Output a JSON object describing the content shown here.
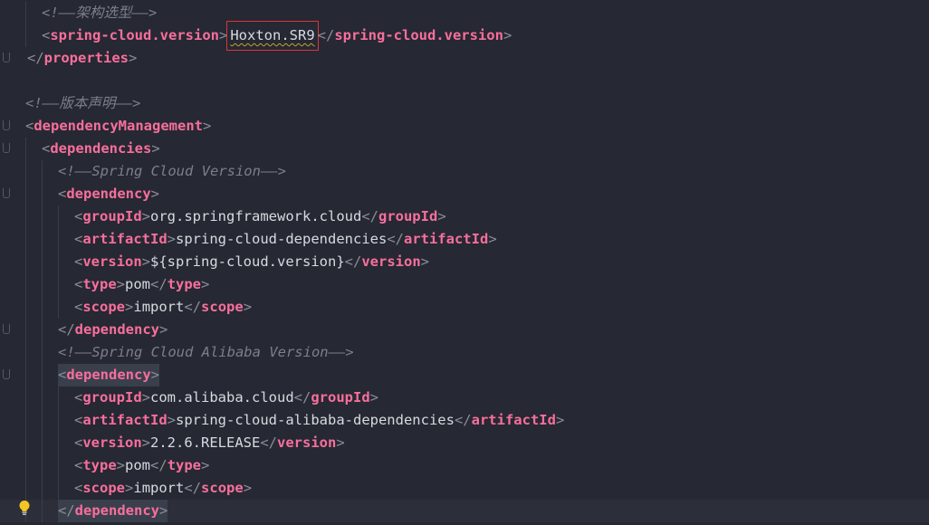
{
  "editor": {
    "lines": [
      {
        "kind": "comment",
        "text": "<!——架构选型——>"
      },
      {
        "kind": "elem",
        "open": "spring-cloud.version",
        "value": "Hoxton.SR9",
        "close": "spring-cloud.version",
        "highlight": true
      },
      {
        "kind": "close",
        "tag": "properties"
      },
      {
        "kind": "blank"
      },
      {
        "kind": "comment",
        "text": "<!——版本声明——>"
      },
      {
        "kind": "open",
        "tag": "dependencyManagement"
      },
      {
        "kind": "open",
        "tag": "dependencies"
      },
      {
        "kind": "comment",
        "text": "<!——Spring Cloud Version——>"
      },
      {
        "kind": "open",
        "tag": "dependency"
      },
      {
        "kind": "elem",
        "open": "groupId",
        "value": "org.springframework.cloud",
        "close": "groupId"
      },
      {
        "kind": "elem",
        "open": "artifactId",
        "value": "spring-cloud-dependencies",
        "close": "artifactId"
      },
      {
        "kind": "elem",
        "open": "version",
        "value": "${spring-cloud.version}",
        "close": "version"
      },
      {
        "kind": "elem",
        "open": "type",
        "value": "pom",
        "close": "type"
      },
      {
        "kind": "elem",
        "open": "scope",
        "value": "import",
        "close": "scope"
      },
      {
        "kind": "close",
        "tag": "dependency"
      },
      {
        "kind": "comment",
        "text": "<!——Spring Cloud Alibaba Version——>"
      },
      {
        "kind": "open",
        "tag": "dependency",
        "match": true
      },
      {
        "kind": "elem",
        "open": "groupId",
        "value": "com.alibaba.cloud",
        "close": "groupId"
      },
      {
        "kind": "elem",
        "open": "artifactId",
        "value": "spring-cloud-alibaba-dependencies",
        "close": "artifactId"
      },
      {
        "kind": "elem",
        "open": "version",
        "value": "2.2.6.RELEASE",
        "close": "version"
      },
      {
        "kind": "elem",
        "open": "type",
        "value": "pom",
        "close": "type"
      },
      {
        "kind": "elem",
        "open": "scope",
        "value": "import",
        "close": "scope"
      },
      {
        "kind": "close",
        "tag": "dependency",
        "match": true,
        "current": true
      }
    ]
  },
  "colors": {
    "background": "#262833",
    "tag": "#f76f9c",
    "text": "#d8dae0",
    "comment": "#7c7f8c",
    "highlight_border": "#d9373a"
  },
  "icons": {
    "gutter_hint": "lightbulb-icon",
    "fold_markers": "fold-marker-icon"
  }
}
